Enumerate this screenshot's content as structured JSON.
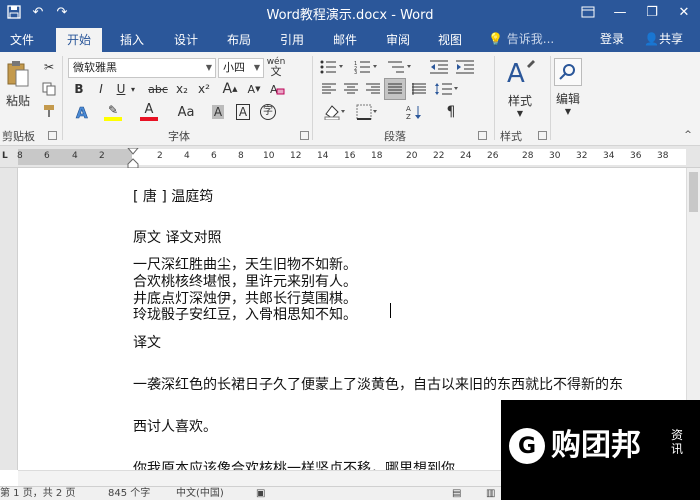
{
  "titlebar": {
    "title": "Word教程演示.docx - Word",
    "qat": [
      "save-icon",
      "undo-icon",
      "redo-icon"
    ],
    "window_buttons": [
      "ribbon-display-icon",
      "minimize-icon",
      "restore-icon",
      "close-icon"
    ]
  },
  "tabs": [
    {
      "label": "文件"
    },
    {
      "label": "开始"
    },
    {
      "label": "插入"
    },
    {
      "label": "设计"
    },
    {
      "label": "布局"
    },
    {
      "label": "引用"
    },
    {
      "label": "邮件"
    },
    {
      "label": "审阅"
    },
    {
      "label": "视图"
    }
  ],
  "tell_me": "告诉我...",
  "signin": "登录",
  "share": "共享",
  "ribbon": {
    "paste_label": "粘贴",
    "clipboard_label": "剪贴板",
    "font_name": "微软雅黑",
    "font_size": "小四",
    "font_label": "字体",
    "paragraph_label": "段落",
    "styles_button": "样式",
    "styles_label": "样式",
    "editing_button": "编辑",
    "wen_icon": "wén",
    "bold": "B",
    "italic": "I",
    "underline": "U",
    "strike": "abc",
    "subscript": "x₂",
    "superscript": "x²",
    "aa_case": "Aa",
    "font_color_a": "A",
    "grow_font": "A",
    "shrink_font": "A"
  },
  "ruler": {
    "ticks": [
      "8",
      "6",
      "4",
      "2",
      "2",
      "4",
      "6",
      "8",
      "10",
      "12",
      "14",
      "16",
      "18",
      "20",
      "22",
      "24",
      "26",
      "28",
      "30",
      "32",
      "34",
      "36",
      "38"
    ]
  },
  "document": {
    "lines": [
      "[ 唐 ] 温庭筠",
      "原文 译文对照",
      "一尺深红胜曲尘，天生旧物不如新。",
      "合欢桃核终堪恨，里许元来别有人。",
      "井底点灯深烛伊，共郎长行莫围棋。",
      "玲珑骰子安红豆，入骨相思知不知。",
      "译文",
      "一袭深红色的长裙日子久了便蒙上了淡黄色，自古以来旧的东西就比不得新的东",
      "西讨人喜欢。",
      "你我原本应该像合欢核桃一样坚贞不移，哪里想到你"
    ]
  },
  "status": {
    "page": "第 1 页，共 2 页",
    "words": "845 个字",
    "language": "中文(中国)"
  },
  "watermark": {
    "logo_letter": "G",
    "brand": "购团邦",
    "side": "资讯"
  },
  "colors": {
    "word_blue": "#2b579a",
    "ribbon_bg": "#f3f3f3",
    "highlight_yellow": "#ffff00",
    "font_red": "#e81123"
  }
}
